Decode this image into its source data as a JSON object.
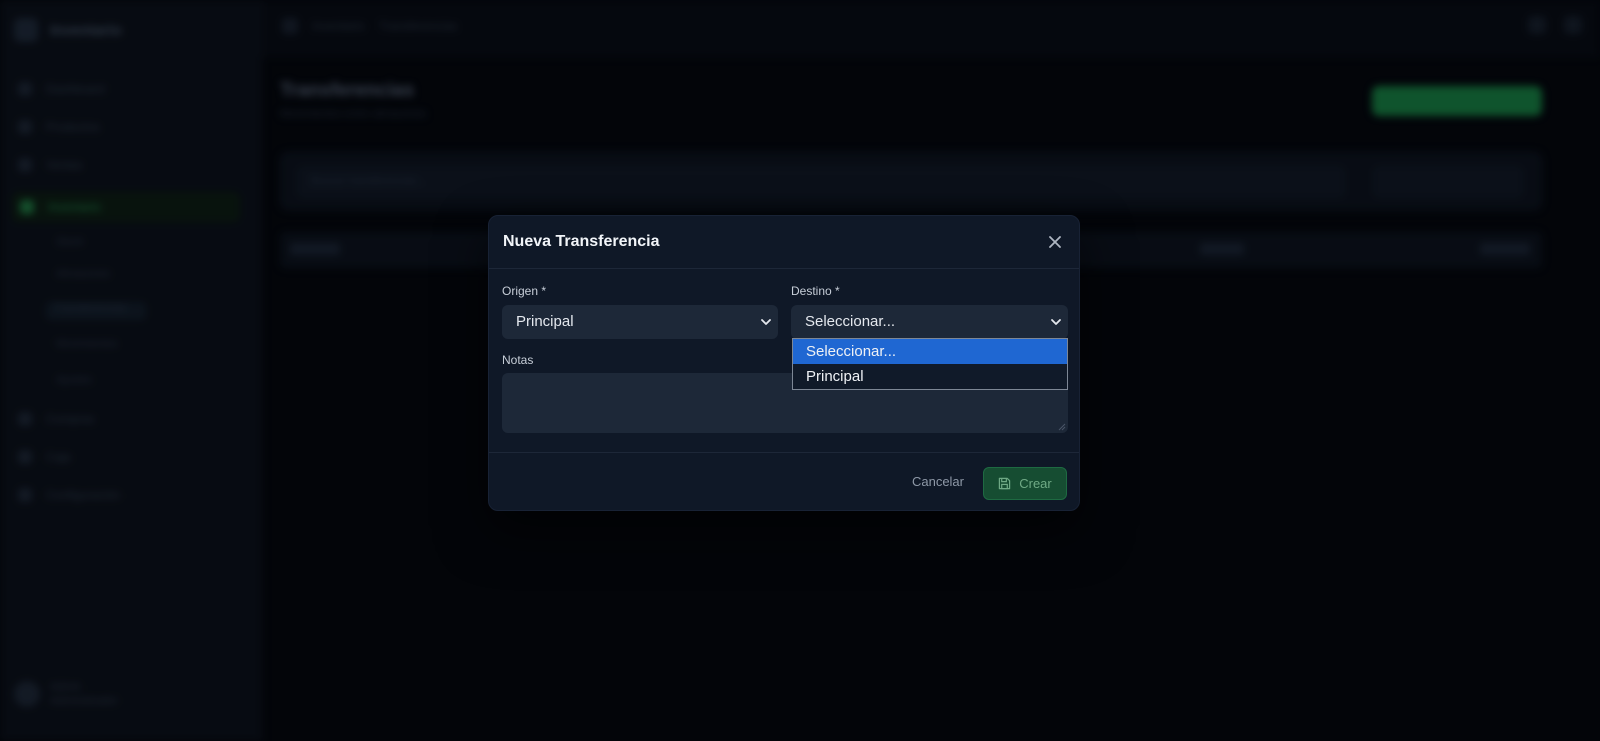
{
  "background": {
    "brand": "Inventario",
    "nav_items": [
      "Dashboard",
      "Productos",
      "Ventas",
      "Inventario",
      "Compras",
      "Caja",
      "Configuración"
    ],
    "sub_items": [
      "Stock",
      "Almacenes",
      "Transferencias",
      "Movimientos",
      "Ajustes"
    ],
    "user": {
      "name": "Admin",
      "role": "Administrador"
    },
    "breadcrumb": [
      "Inventario",
      "Transferencias"
    ],
    "page_title": "Transferencias",
    "page_subtitle": "Movimientos entre almacenes",
    "search_placeholder": "Buscar transferencias..."
  },
  "modal": {
    "title": "Nueva Transferencia",
    "close_icon": "close-icon",
    "origin": {
      "label": "Origen *",
      "value": "Principal"
    },
    "destination": {
      "label": "Destino *",
      "value": "Seleccionar...",
      "options": [
        "Seleccionar...",
        "Principal"
      ],
      "selected_index": 0
    },
    "notes": {
      "label": "Notas",
      "value": "",
      "placeholder": ""
    },
    "cancel_label": "Cancelar",
    "create_label": "Crear",
    "create_icon": "save-icon"
  },
  "colors": {
    "accent": "#164d32",
    "highlight": "#1f67d2",
    "modal_bg": "#0f1827",
    "field_bg": "#1d2838"
  }
}
